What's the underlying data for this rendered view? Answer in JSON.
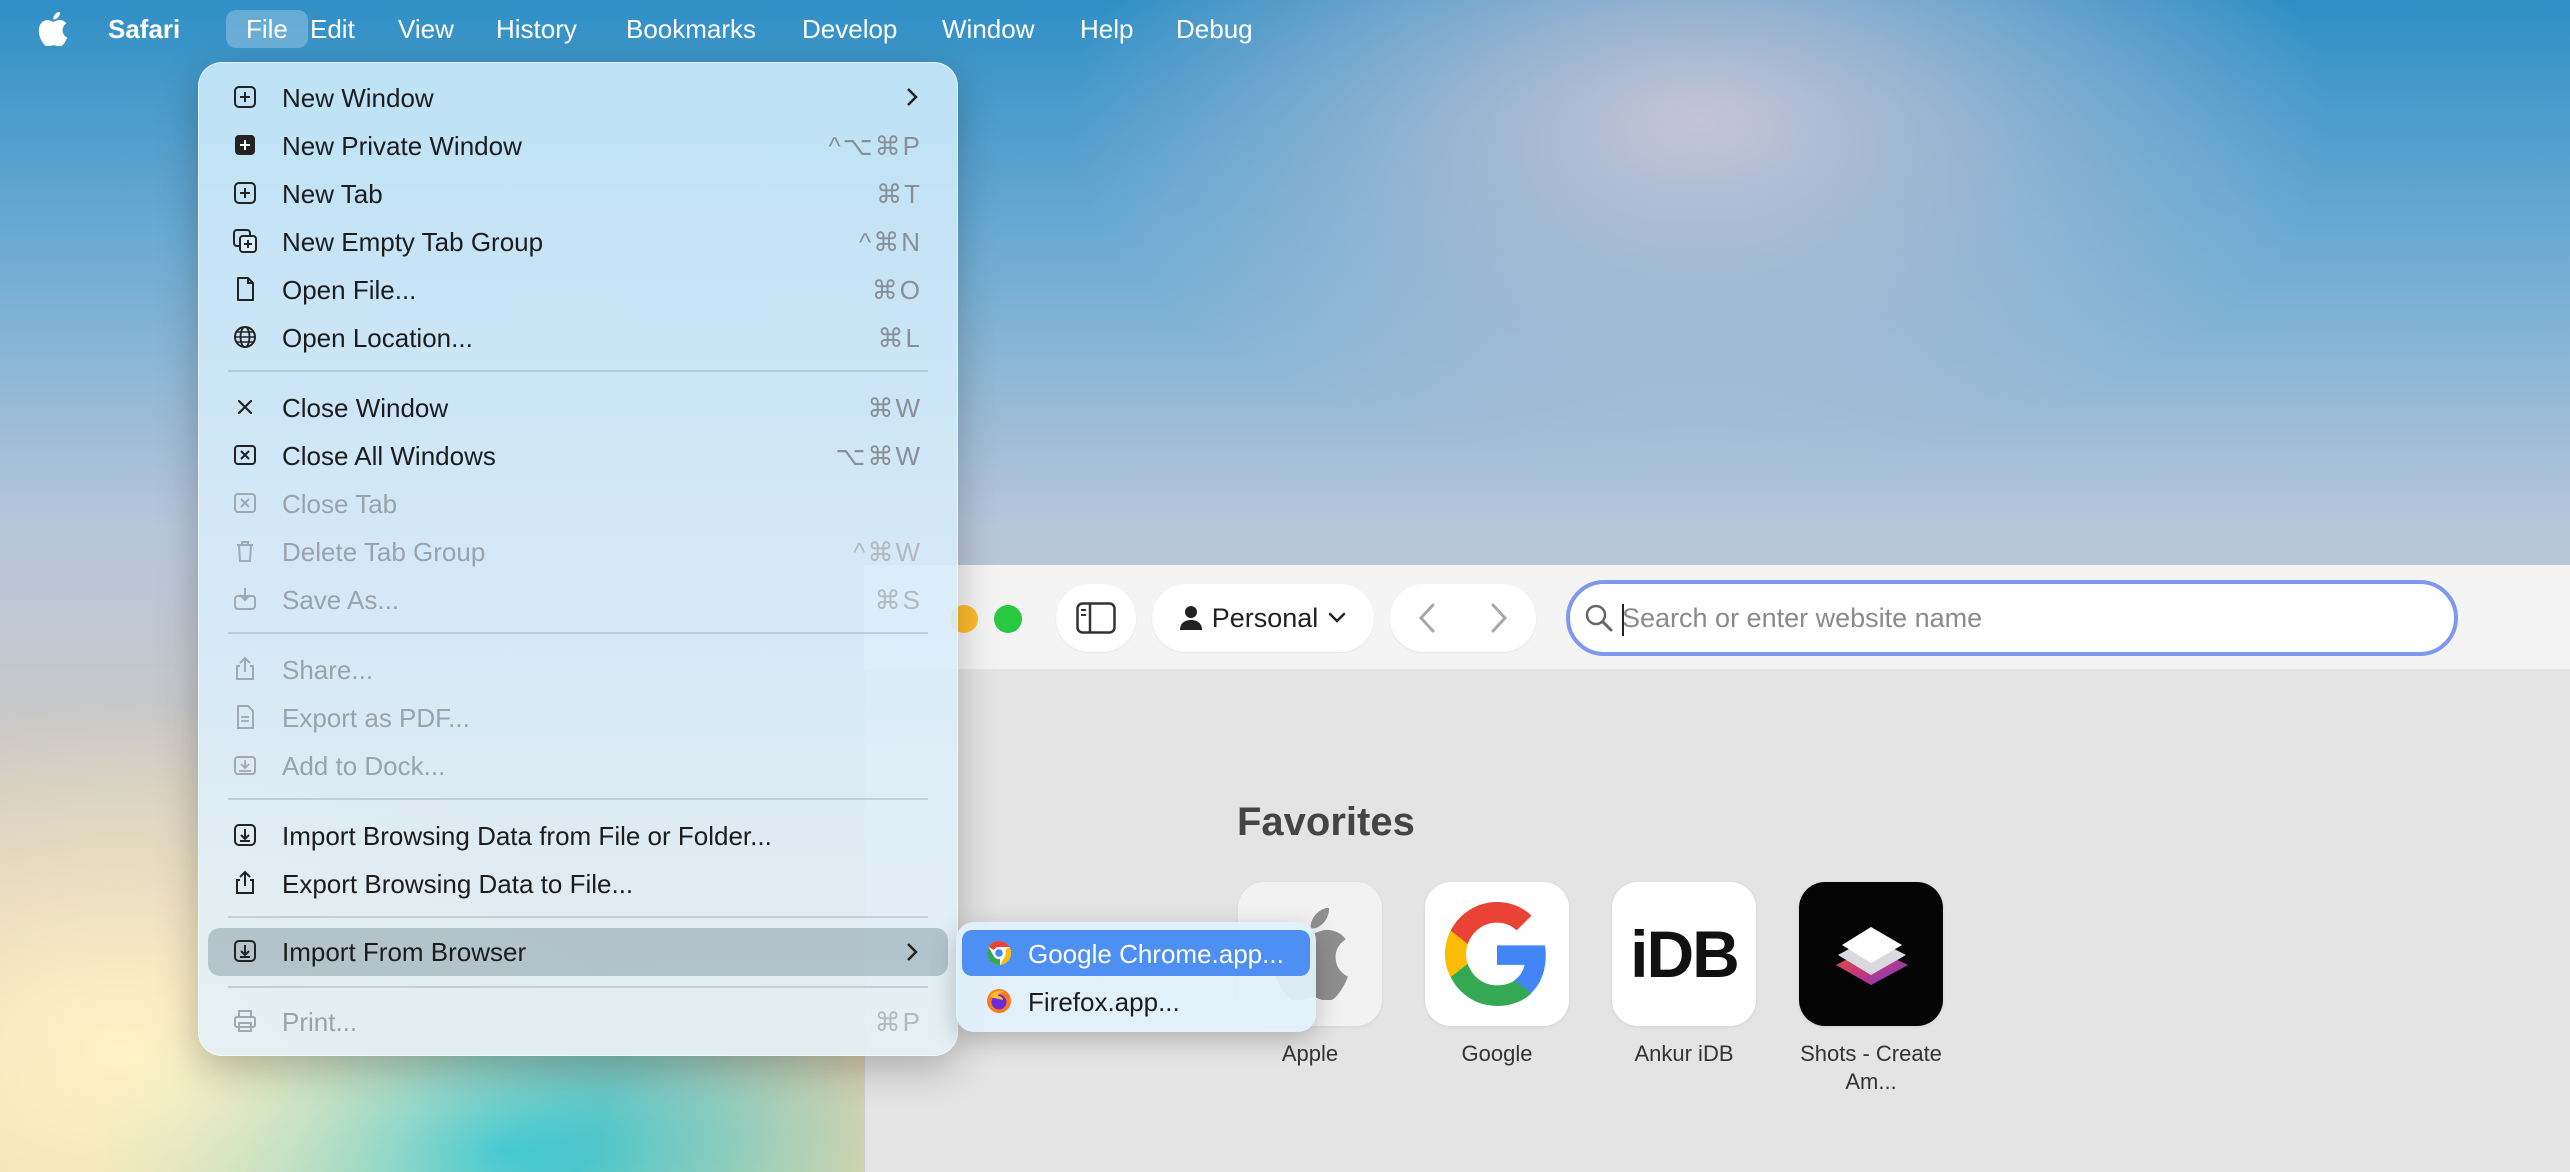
{
  "menubar": {
    "app_name": "Safari",
    "items": [
      "File",
      "Edit",
      "View",
      "History",
      "Bookmarks",
      "Develop",
      "Window",
      "Help",
      "Debug"
    ]
  },
  "file_menu": {
    "items": [
      {
        "label": "New Window",
        "shortcut": "",
        "icon": "plus-square-icon",
        "submenu": true
      },
      {
        "label": "New Private Window",
        "shortcut": "^⌥⌘P",
        "icon": "private-window-icon"
      },
      {
        "label": "New Tab",
        "shortcut": "⌘T",
        "icon": "plus-square-icon"
      },
      {
        "label": "New Empty Tab Group",
        "shortcut": "^⌘N",
        "icon": "tab-group-icon"
      },
      {
        "label": "Open File...",
        "shortcut": "⌘O",
        "icon": "document-icon"
      },
      {
        "label": "Open Location...",
        "shortcut": "⌘L",
        "icon": "globe-icon"
      },
      {
        "label": "Close Window",
        "shortcut": "⌘W",
        "icon": "x-icon"
      },
      {
        "label": "Close All Windows",
        "shortcut": "⌥⌘W",
        "icon": "x-square-icon"
      },
      {
        "label": "Close Tab",
        "shortcut": "",
        "icon": "x-square-icon",
        "disabled": true
      },
      {
        "label": "Delete Tab Group",
        "shortcut": "^⌘W",
        "icon": "trash-icon",
        "disabled": true
      },
      {
        "label": "Save As...",
        "shortcut": "⌘S",
        "icon": "save-icon",
        "disabled": true
      },
      {
        "label": "Share...",
        "shortcut": "",
        "icon": "share-icon",
        "disabled": true
      },
      {
        "label": "Export as PDF...",
        "shortcut": "",
        "icon": "pdf-icon",
        "disabled": true
      },
      {
        "label": "Add to Dock...",
        "shortcut": "",
        "icon": "dock-icon",
        "disabled": true
      },
      {
        "label": "Import Browsing Data from File or Folder...",
        "shortcut": "",
        "icon": "import-icon"
      },
      {
        "label": "Export Browsing Data to File...",
        "shortcut": "",
        "icon": "export-icon"
      },
      {
        "label": "Import From Browser",
        "shortcut": "",
        "icon": "import-icon",
        "submenu": true,
        "highlighted": true
      },
      {
        "label": "Print...",
        "shortcut": "⌘P",
        "icon": "printer-icon",
        "disabled": true
      }
    ]
  },
  "import_submenu": {
    "items": [
      {
        "label": "Google Chrome.app...",
        "icon": "chrome-icon",
        "selected": true
      },
      {
        "label": "Firefox.app...",
        "icon": "firefox-icon"
      }
    ]
  },
  "toolbar": {
    "profile_label": "Personal",
    "search_placeholder": "Search or enter website name"
  },
  "favorites": {
    "title": "Favorites",
    "items": [
      {
        "label": "Apple",
        "icon": "apple-logo-icon"
      },
      {
        "label": "Google",
        "icon": "google-logo-icon"
      },
      {
        "label": "Ankur iDB",
        "icon": "idb-logo-icon",
        "text": "iDB"
      },
      {
        "label": "Shots - Create Am...",
        "icon": "shots-app-icon"
      }
    ]
  },
  "colors": {
    "accent": "#4d8ff2",
    "search_border": "#7d98ee",
    "traffic_yellow": "#febc2e",
    "traffic_green": "#28c840"
  }
}
